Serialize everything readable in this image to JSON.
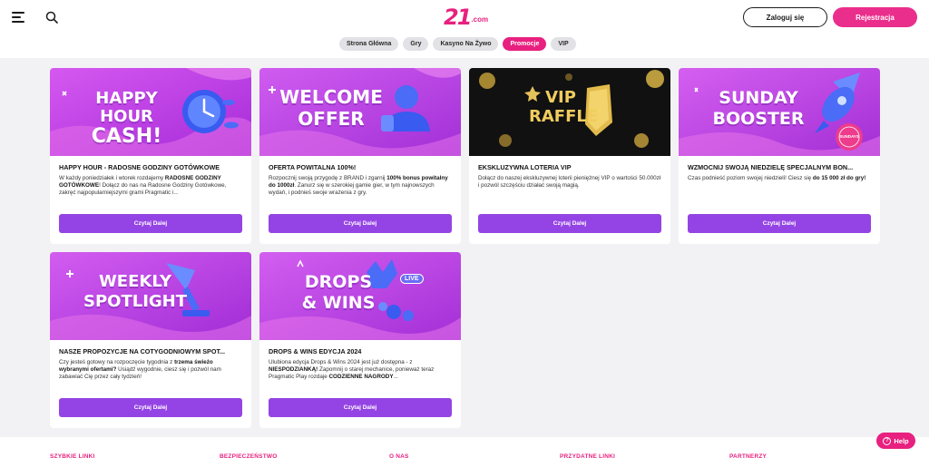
{
  "header": {
    "logo_mark": "21",
    "logo_suffix": ".com",
    "login_label": "Zaloguj się",
    "register_label": "Rejestracja"
  },
  "nav": {
    "tabs": [
      {
        "label": "Strona Główna",
        "active": false
      },
      {
        "label": "Gry",
        "active": false
      },
      {
        "label": "Kasyno Na Żywo",
        "active": false
      },
      {
        "label": "Promocje",
        "active": true
      },
      {
        "label": "VIP",
        "active": false
      }
    ]
  },
  "promos": [
    {
      "banner_line1": "HAPPY HOUR",
      "banner_line2": "CASH!",
      "title": "HAPPY HOUR - RADOSNE GODZINY GOTÓWKOWE",
      "desc_parts": [
        {
          "t": "W każdy poniedziałek i wtorek rozdajemy ",
          "b": false
        },
        {
          "t": "RADOSNE GODZINY GOTÓWKOWE",
          "b": true
        },
        {
          "t": "! Dołącz do nas na Radosne Godziny Gotówkowe, zakręć najpopularniejszymi grami Pragmatic i...",
          "b": false
        }
      ],
      "button": "Czytaj Dalej"
    },
    {
      "banner_line1": "WELCOME",
      "banner_line2": "OFFER",
      "title": "OFERTA POWITALNA 100%!",
      "desc_parts": [
        {
          "t": "Rozpocznij swoją przygodę z BRAND i zgarnij ",
          "b": false
        },
        {
          "t": "100% bonus powitalny do 1000zł",
          "b": true
        },
        {
          "t": ". Zanurz się w szerokiej gamie gier, w tym najnowszych wydań, i podnieś swoje wrażenia z gry.",
          "b": false
        }
      ],
      "button": "Czytaj Dalej"
    },
    {
      "banner_line1": "VIP",
      "banner_line2": "RAFFLE",
      "title": "EKSKLUZYWNA LOTERIA VIP",
      "desc_parts": [
        {
          "t": "Dołącz do naszej ekskluzywnej loterii pieniężnej VIP o wartości 50.000zł i pozwól szczęściu działać swoją magią.",
          "b": false
        }
      ],
      "button": "Czytaj Dalej"
    },
    {
      "banner_line1": "SUNDAY",
      "banner_line2": "BOOSTER",
      "stamp": "SUNDAYS",
      "title": "WZMOCNIJ SWOJĄ NIEDZIELĘ SPECJALNYM BON...",
      "desc_parts": [
        {
          "t": "Czas podnieść poziom swojej niedzieli! Ciesz się ",
          "b": false
        },
        {
          "t": "do 15 000 zł do gry!",
          "b": true
        }
      ],
      "button": "Czytaj Dalej"
    },
    {
      "banner_line1": "WEEKLY",
      "banner_line2": "SPOTLIGHT",
      "title": "NASZE PROPOZYCJE NA COTYGODNIOWYM SPOT...",
      "desc_parts": [
        {
          "t": "Czy jesteś gotowy na rozpoczęcie tygodnia z ",
          "b": false
        },
        {
          "t": "trzema świeżo wybranymi ofertami?",
          "b": true
        },
        {
          "t": " Usiądź wygodnie, ciesz się i pozwól nam zabawiać Cię przez cały tydzień!",
          "b": false
        }
      ],
      "button": "Czytaj Dalej"
    },
    {
      "banner_line1": "DROPS",
      "banner_line2": "& WINS",
      "badge": "LIVE",
      "title": "DROPS & WINS EDYCJA 2024",
      "desc_parts": [
        {
          "t": "Ulubiona edycja Drops & Wins 2024 jest już dostępna - z ",
          "b": false
        },
        {
          "t": "NIESPODZIANKĄ!",
          "b": true
        },
        {
          "t": " Zapomnij o starej mechanice, ponieważ teraz Pragmatic Play rozdaje ",
          "b": false
        },
        {
          "t": "CODZIENNE NAGRODY",
          "b": true
        },
        {
          "t": "...",
          "b": false
        }
      ],
      "button": "Czytaj Dalej"
    }
  ],
  "footer": {
    "links": [
      "SZYBKIE LINKI",
      "BEZPIECZEŃSTWO",
      "O NAS",
      "PRZYDATNE LINKI",
      "PARTNERZY"
    ]
  },
  "help": {
    "label": "Help",
    "icon": "?"
  },
  "colors": {
    "brand_pink": "#e8207f",
    "button_purple": "#9444e4",
    "banner_purple": "#c23fe6"
  }
}
